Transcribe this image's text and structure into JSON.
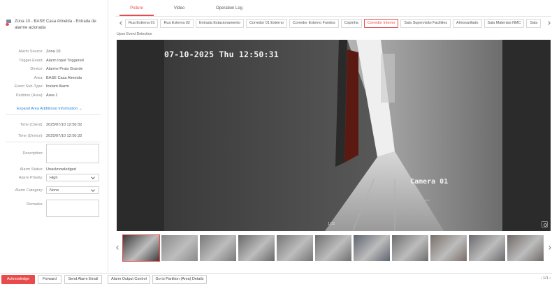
{
  "alarm": {
    "title": "Zona 10 - BASE Casa Almeida - Entrada de alarme acionada",
    "details": [
      {
        "label": "Alarm Source:",
        "value": "Zona 10"
      },
      {
        "label": "Trigger Event:",
        "value": "Alarm Input Triggered"
      },
      {
        "label": "Device:",
        "value": "Alarme Praia Grande"
      },
      {
        "label": "Area:",
        "value": "BASE Casa Almeida"
      },
      {
        "label": "Event Sub-Type:",
        "value": "Instant Alarm"
      },
      {
        "label": "Partition (Area):",
        "value": "Área 1"
      }
    ],
    "expand_label": "Expand Area Additional Information",
    "times": [
      {
        "label": "Time (Client):",
        "value": "2025/07/10 12:50:32"
      },
      {
        "label": "Time (Device):",
        "value": "2025/07/10 12:50:32"
      }
    ]
  },
  "form": {
    "description_label": "Description:",
    "status_label": "Alarm Status:",
    "status_value": "Unacknowledged",
    "priority_label": "Alarm Priority:",
    "priority_value": "High",
    "category_label": "Alarm Category:",
    "category_value": "None",
    "remarks_label": "Remarks:"
  },
  "tabs": [
    "Picture",
    "Video",
    "Operation Log"
  ],
  "cameras": [
    "Rua Externa 01",
    "Rua Externa 02",
    "Entrada Estacionamento",
    "Corredor 01 Externo",
    "Corredor Externo Fundos",
    "Copinha",
    "Corredor Interno",
    "Sala Supervisão Facilities",
    "Almoxarifado",
    "Sala Materiais NMC",
    "Sala"
  ],
  "active_camera": 6,
  "event_label": "Upon Event Detection",
  "viewer": {
    "osd_timestamp": "07-10-2025 Thu 12:50:31",
    "osd_camera": "Camera 01",
    "counter": "1/11"
  },
  "thumbnails": {
    "count": 11,
    "active_index": 0,
    "tones": [
      "#3c3c3c",
      "#8a8a8a",
      "#7a7a7a",
      "#6a6a6a",
      "#767676",
      "#707070",
      "#5f6470",
      "#6e6e6e",
      "#7a6f68",
      "#6c6a6f",
      "#706a66"
    ]
  },
  "footer": {
    "acknowledge": "Acknowledge",
    "forward": "Forward",
    "send_email": "Send Alarm Email",
    "output_control": "Alarm Output Control",
    "go_partition": "Go to Partition (Area) Details",
    "pager": "1/1"
  },
  "colors": {
    "accent": "#e84b4b",
    "link": "#2e8ad8"
  }
}
